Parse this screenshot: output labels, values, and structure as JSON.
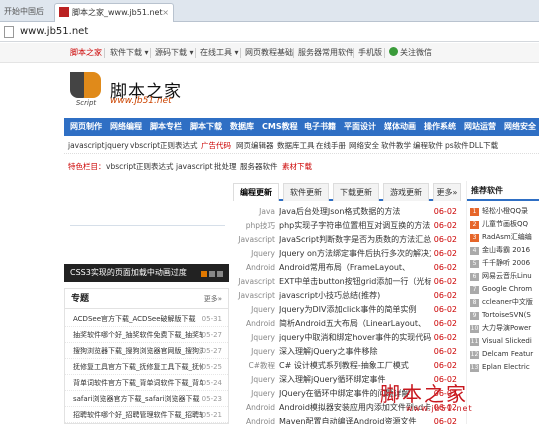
{
  "browser": {
    "tabs": [
      {
        "label": "开始中国后"
      },
      {
        "label": "脚本之家_www.jb51.net"
      }
    ],
    "address": "www.jb51.net"
  },
  "topnav": {
    "items": [
      "脚本之家",
      "软件下载 ▾",
      "源码下载 ▾",
      "在线工具 ▾",
      "网页教程基础",
      "服务器常用软件",
      "手机版",
      "关注微信"
    ]
  },
  "header": {
    "site_name": "脚本之家",
    "site_url": "www.jb51.net",
    "logo_sub": "Script"
  },
  "mainnav": {
    "items": [
      "网页制作",
      "网络编程",
      "脚本专栏",
      "脚本下载",
      "数据库",
      "CMS教程",
      "电子书籍",
      "平面设计",
      "媒体动画",
      "操作系统",
      "网站运营",
      "网络安全"
    ]
  },
  "subrow1": [
    "javascript",
    "jquery",
    "vbscript",
    "正则表达式",
    "广告代码",
    "网页编辑器",
    "数据库工具",
    "在线手册",
    "网络安全",
    "软件教学",
    "编程软件",
    "ps软件",
    "DLL下载"
  ],
  "subrow2": [
    "特色栏目：",
    "vbscript",
    "正则表达式",
    "javascript",
    "批处理",
    "服务器软件",
    "素材下载"
  ],
  "banner": {
    "caption": "CSS3实现的页面加载中动画过度"
  },
  "topic": {
    "title": "专题",
    "more": "更多»",
    "items": [
      {
        "text": "ACDSee官方下载_ACDSee破解版下载",
        "date": "05-31"
      },
      {
        "text": "抽奖软件哪个好_抽奖软件免费下载_抽奖软件",
        "date": "05-27"
      },
      {
        "text": "搜狗浏览器下载_搜狗浏览器官网版_搜狗浏览",
        "date": "05-27"
      },
      {
        "text": "抚修复工具官方下载_抚修复工具下载_抚修复",
        "date": "05-25"
      },
      {
        "text": "背单词软件官方下载_背单词软件下载_背单词",
        "date": "05-24"
      },
      {
        "text": "safari浏览器官方下载_safari浏览器下载",
        "date": "05-23"
      },
      {
        "text": "招聘软件哪个好_招聘管理软件下载_招聘软",
        "date": "05-21"
      }
    ]
  },
  "middle": {
    "tabs": [
      "编程更新",
      "软件更新",
      "下载更新",
      "游戏更新",
      "更多»"
    ],
    "rows": [
      {
        "cat": "Java",
        "title": "Java后台处理Json格式数据的方法",
        "date": "06-02"
      },
      {
        "cat": "php技巧",
        "title": "php实现子字符串位置相互对调互换的方法",
        "date": "06-02"
      },
      {
        "cat": "Javascript",
        "title": "JavaScript判断数字是否为质数的方法汇总",
        "date": "06-02"
      },
      {
        "cat": "Jquery",
        "title": "Jquery on方法绑定事件后执行多次的解决方",
        "date": "06-02"
      },
      {
        "cat": "Android",
        "title": "Android常用布局（FrameLayout、",
        "date": "06-02"
      },
      {
        "cat": "Javascript",
        "title": "EXT中单击button按钮grid添加一行（光标位",
        "date": "06-02"
      },
      {
        "cat": "Javascript",
        "title": "javascript小技巧总结(推荐)",
        "date": "06-02"
      },
      {
        "cat": "Jquery",
        "title": "Jquery为DIV添加click事件的简单实例",
        "date": "06-02"
      },
      {
        "cat": "Android",
        "title": "简析Android五大布局（LinearLayout、",
        "date": "06-02"
      },
      {
        "cat": "Jquery",
        "title": "jquery中取消和绑定hover事件的实现代码",
        "date": "06-02"
      },
      {
        "cat": "Jquery",
        "title": "深入理解jQuery之事件移除",
        "date": "06-02"
      },
      {
        "cat": "C#教程",
        "title": "C# 设计模式系列教程-抽象工厂模式",
        "date": "06-02"
      },
      {
        "cat": "Jquery",
        "title": "深入理解jQuery循环绑定事件",
        "date": "06-02"
      },
      {
        "cat": "Jquery",
        "title": "JQuery在循环中绑定事件的问题详解",
        "date": "06-02"
      },
      {
        "cat": "Android",
        "title": "Android模拟器安装应用内添加文件到sd卡的方",
        "date": "06-02"
      },
      {
        "cat": "Android",
        "title": "Maven配置自动编译Android资源文件",
        "date": "06-02"
      }
    ]
  },
  "right": {
    "title": "推荐软件",
    "items": [
      {
        "n": "1",
        "text": "轻松小橙QQ录"
      },
      {
        "n": "2",
        "text": "儿童节画板QQ"
      },
      {
        "n": "3",
        "text": "RadAsm汇编编"
      },
      {
        "n": "4",
        "text": "金山毒霸 2016"
      },
      {
        "n": "5",
        "text": "千千静听 2006"
      },
      {
        "n": "6",
        "text": "网易云音乐Linu"
      },
      {
        "n": "7",
        "text": "Google Chrom"
      },
      {
        "n": "8",
        "text": "ccleaner中文版"
      },
      {
        "n": "9",
        "text": "TortoiseSVN(S"
      },
      {
        "n": "10",
        "text": "大力导演Power"
      },
      {
        "n": "11",
        "text": "Visual Slickedi"
      },
      {
        "n": "12",
        "text": "Delcam Featur"
      },
      {
        "n": "13",
        "text": "Eplan Electric"
      }
    ]
  },
  "watermark": {
    "big": "脚本之家",
    "small": "www.jb51.net"
  }
}
